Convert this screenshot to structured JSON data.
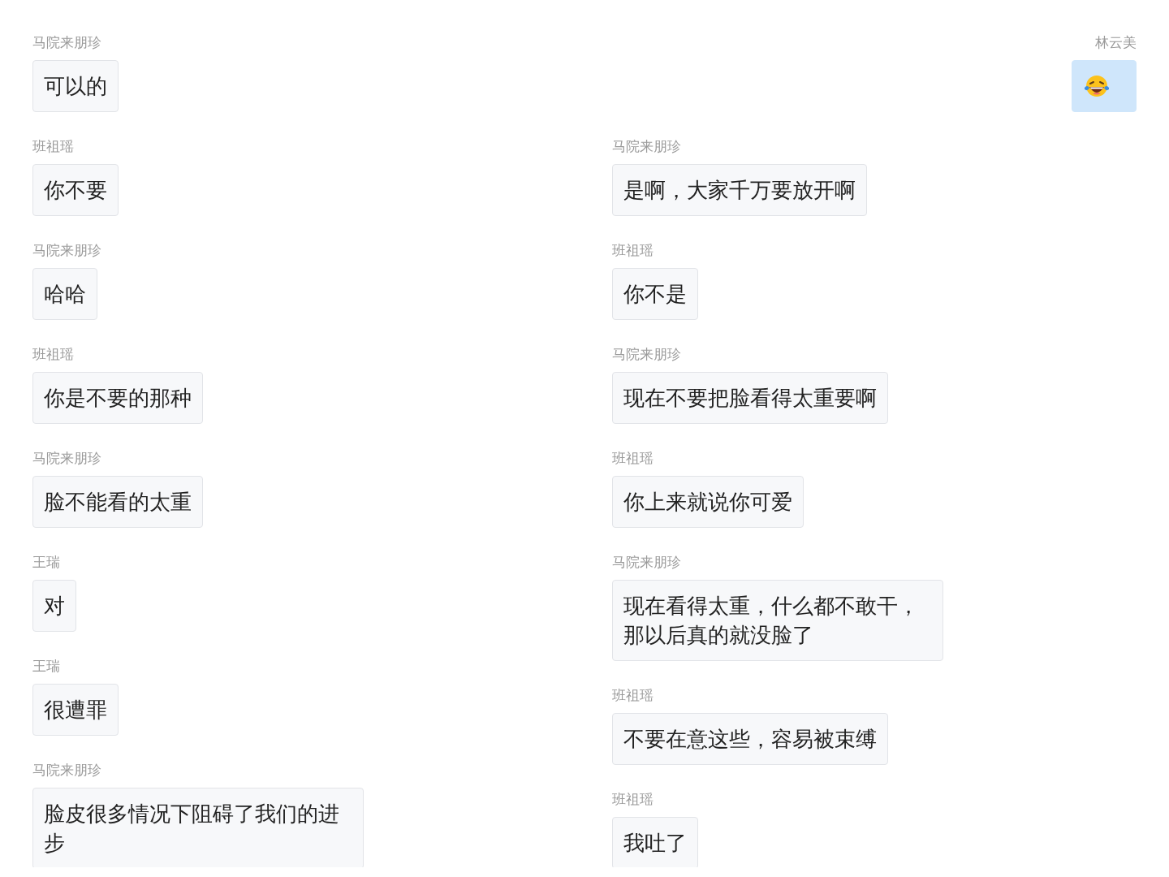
{
  "own_message": {
    "sender": "林云美",
    "kind": "emoji"
  },
  "left_column": [
    {
      "sender": "马院来朋珍",
      "text": "可以的"
    },
    {
      "sender": "班祖瑶",
      "text": "你不要"
    },
    {
      "sender": "马院来朋珍",
      "text": "哈哈"
    },
    {
      "sender": "班祖瑶",
      "text": "你是不要的那种"
    },
    {
      "sender": "马院来朋珍",
      "text": "脸不能看的太重"
    },
    {
      "sender": "王瑞",
      "text": "对"
    },
    {
      "sender": "王瑞",
      "text": "很遭罪"
    },
    {
      "sender": "马院来朋珍",
      "text": "脸皮很多情况下阻碍了我们的进步"
    }
  ],
  "right_column": [
    {
      "sender": "马院来朋珍",
      "text": "是啊，大家千万要放开啊"
    },
    {
      "sender": "班祖瑶",
      "text": "你不是"
    },
    {
      "sender": "马院来朋珍",
      "text": "现在不要把脸看得太重要啊"
    },
    {
      "sender": "班祖瑶",
      "text": "你上来就说你可爱"
    },
    {
      "sender": "马院来朋珍",
      "text": "现在看得太重，什么都不敢干，那以后真的就没脸了"
    },
    {
      "sender": "班祖瑶",
      "text": "不要在意这些，容易被束缚"
    },
    {
      "sender": "班祖瑶",
      "text": "我吐了"
    }
  ]
}
